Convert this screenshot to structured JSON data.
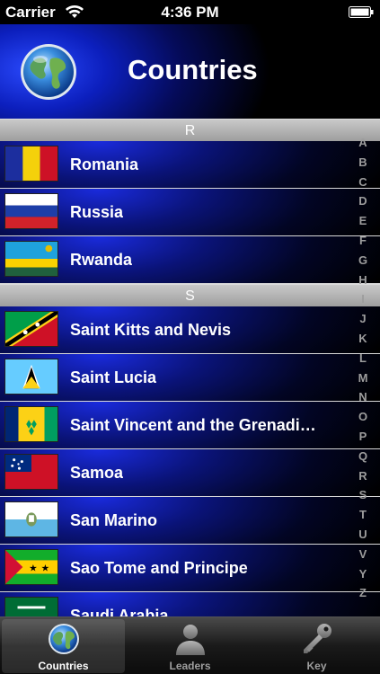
{
  "status": {
    "carrier": "Carrier",
    "time": "4:36 PM"
  },
  "header": {
    "title": "Countries",
    "accent": "#1428d6"
  },
  "sections": [
    {
      "letter": "R",
      "rows": [
        "Romania",
        "Russia",
        "Rwanda"
      ]
    },
    {
      "letter": "S",
      "rows": [
        "Saint Kitts and Nevis",
        "Saint Lucia",
        "Saint Vincent and the Grenadi…",
        "Samoa",
        "San Marino",
        "Sao Tome and Principe",
        "Saudi Arabia"
      ]
    }
  ],
  "index": [
    "A",
    "B",
    "C",
    "D",
    "E",
    "F",
    "G",
    "H",
    "I",
    "J",
    "K",
    "L",
    "M",
    "N",
    "O",
    "P",
    "Q",
    "R",
    "S",
    "T",
    "U",
    "V",
    "Y",
    "Z"
  ],
  "tabs": [
    {
      "label": "Countries",
      "icon": "globe-icon",
      "selected": true
    },
    {
      "label": "Leaders",
      "icon": "person-icon",
      "selected": false
    },
    {
      "label": "Key",
      "icon": "key-icon",
      "selected": false
    }
  ]
}
